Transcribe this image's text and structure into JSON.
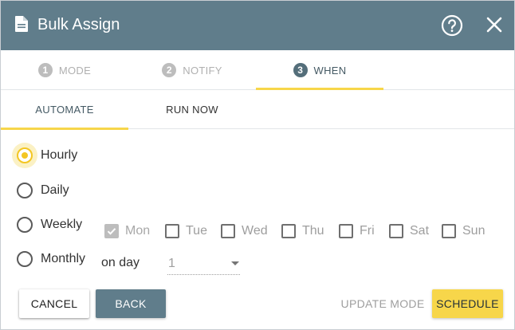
{
  "dialog": {
    "title": "Bulk Assign",
    "header_color": "#607d8b",
    "accent_color": "#f7d64a"
  },
  "icons": {
    "document": "document-icon",
    "help": "help-circle-icon",
    "close": "close-icon"
  },
  "stepper": {
    "steps": [
      {
        "number": "1",
        "label": "MODE",
        "active": false
      },
      {
        "number": "2",
        "label": "NOTIFY",
        "active": false
      },
      {
        "number": "3",
        "label": "WHEN",
        "active": true
      }
    ]
  },
  "tabs": {
    "items": [
      {
        "label": "AUTOMATE",
        "active": true
      },
      {
        "label": "RUN NOW",
        "active": false
      }
    ]
  },
  "frequency": {
    "selected": "Hourly",
    "options": [
      "Hourly",
      "Daily",
      "Weekly",
      "Monthly"
    ]
  },
  "weekdays": [
    {
      "label": "Mon",
      "checked": true
    },
    {
      "label": "Tue",
      "checked": false
    },
    {
      "label": "Wed",
      "checked": false
    },
    {
      "label": "Thu",
      "checked": false
    },
    {
      "label": "Fri",
      "checked": false
    },
    {
      "label": "Sat",
      "checked": false
    },
    {
      "label": "Sun",
      "checked": false
    }
  ],
  "monthly": {
    "on_day_label": "on day",
    "day_value": "1"
  },
  "footer": {
    "cancel_label": "CANCEL",
    "back_label": "BACK",
    "update_mode_label": "UPDATE MODE",
    "schedule_label": "SCHEDULE"
  }
}
